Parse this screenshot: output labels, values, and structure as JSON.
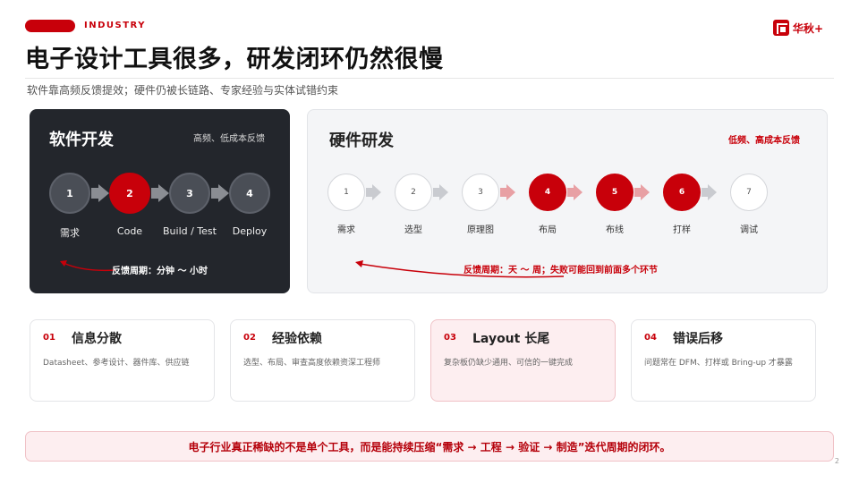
{
  "header": {
    "tag": "INDUSTRY",
    "logo_text": "华秋",
    "logo_plus": "+",
    "title": "电子设计工具很多，研发闭环仍然很慢",
    "subtitle": "软件靠高频反馈提效；硬件仍被长链路、专家经验与实体试错约束"
  },
  "software": {
    "title": "软件开发",
    "note": "高频、低成本反馈",
    "steps": [
      {
        "num": "1",
        "label": "需求"
      },
      {
        "num": "2",
        "label": "Code"
      },
      {
        "num": "3",
        "label": "Build / Test"
      },
      {
        "num": "4",
        "label": "Deploy"
      }
    ],
    "feedback_label": "反馈周期：",
    "feedback_value": "分钟 ～ 小时"
  },
  "hardware": {
    "title": "硬件研发",
    "note": "低频、高成本反馈",
    "steps": [
      {
        "num": "1",
        "label": "需求"
      },
      {
        "num": "2",
        "label": "选型"
      },
      {
        "num": "3",
        "label": "原理图"
      },
      {
        "num": "4",
        "label": "布局"
      },
      {
        "num": "5",
        "label": "布线"
      },
      {
        "num": "6",
        "label": "打样"
      },
      {
        "num": "7",
        "label": "调试"
      }
    ],
    "feedback": "反馈周期：天 ～ 周；失败可能回到前面多个环节"
  },
  "cards": [
    {
      "num": "01",
      "title": "信息分散",
      "body": "Datasheet、参考设计、器件库、供应链"
    },
    {
      "num": "02",
      "title": "经验依赖",
      "body": "选型、布局、审查高度依赖资深工程师"
    },
    {
      "num": "03",
      "title": "Layout 长尾",
      "body": "复杂板仍缺少通用、可信的一键完成"
    },
    {
      "num": "04",
      "title": "错误后移",
      "body": "问题常在 DFM、打样或 Bring-up 才暴露"
    }
  ],
  "banner": "电子行业真正稀缺的不是单个工具，而是能持续压缩“需求 → 工程 → 验证 → 制造”迭代周期的闭环。",
  "page_number": "2",
  "colors": {
    "accent": "#c8000a",
    "dark_panel": "#23262c",
    "light_panel": "#f4f5f7"
  }
}
